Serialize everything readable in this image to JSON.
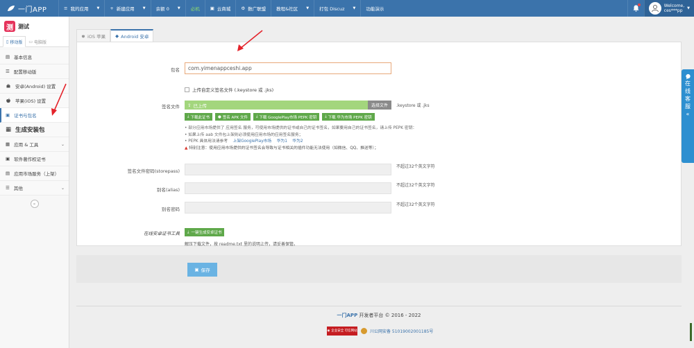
{
  "navbar": {
    "brand": "一门APP",
    "items": [
      {
        "label": "我的应用",
        "caret": true
      },
      {
        "label": "新建应用",
        "caret": true
      },
      {
        "label": "余额 0",
        "caret": true
      },
      {
        "label": "云商城"
      },
      {
        "label": "数广联盟"
      },
      {
        "label": "教程&社区",
        "caret": true
      },
      {
        "label": "打包 Discuz",
        "caret": true
      },
      {
        "label": "功能演示"
      }
    ],
    "live_label": "必机",
    "user_welcome": "Welcome,",
    "user_name": "ces***pp"
  },
  "sidebar": {
    "app_name": "测试",
    "app_logo_char": "测",
    "tabs": [
      "移动版",
      "电脑版"
    ],
    "menu": [
      {
        "label": "基本信息",
        "icon": "document-icon"
      },
      {
        "label": "配置移动版",
        "icon": "list-icon"
      },
      {
        "label": "安卓(Android) 设置",
        "icon": "android-icon"
      },
      {
        "label": "苹果(iOS) 设置",
        "icon": "apple-icon"
      },
      {
        "label": "证书与包名",
        "icon": "certificate-icon",
        "active": true
      },
      {
        "label": "生成安装包",
        "icon": "package-icon",
        "section": true
      },
      {
        "label": "应用 & 工具",
        "icon": "grid-icon",
        "chevron": true
      },
      {
        "label": "软件著作权证书",
        "icon": "copyright-icon"
      },
      {
        "label": "应用市场服务（上架）",
        "icon": "store-icon"
      },
      {
        "label": "其他",
        "icon": "menu-icon",
        "chevron": true
      }
    ]
  },
  "tabs": {
    "ios": "iOS 苹果",
    "android": "Android 安卓"
  },
  "form": {
    "package_label": "包名",
    "package_value": "com.yimenappceshi.app",
    "custom_sign_checkbox": "上传自定义签名文件 (.keystore 或 .jks)",
    "sign_file_label": "签名文件",
    "uploaded_text": "已上传",
    "choose_file_button": "选择文件",
    "file_types": ".keystore 或 .jks",
    "buttons": [
      "下载此证书",
      "签名 APK 文件",
      "下载 GooglePlay市场 PEPK 密钥",
      "下载 华为市场 PEPK 密钥"
    ],
    "notes": [
      "• 部分应用市场提供了 应用签名 服务，可使用市场提供的证书或自己的证书签名，如果要用自己的证书签名，请上传 PEPK 密钥：",
      "• 如果上传 aab 文件包上架则必须使用应用市场的应用签名服务；",
      "• PEPK 具体用法请参考",
      "特别注意：使用应用市场提供的证书签名会导致与证书相关的插件功能无法使用（如微信、QQ、推送等）；"
    ],
    "ref_links": [
      "上架GooglePlay市场",
      "华为1",
      "华为2"
    ],
    "storepass_label": "签名文件密码(storepass)",
    "alias_label": "别名(alias)",
    "alias_pass_label": "别名密码",
    "limit_hint": "不超过32个英文字符",
    "tool_label": "在线安卓证书工具",
    "tool_button": "一键生成安卓证书",
    "tool_note": "解压下载文件，按 readme.txt 里的说明上传，请妥善保管。"
  },
  "save_button": "保存",
  "footer": {
    "brand": "一门APP",
    "text": " 开发者平台 © 2016 - 2022",
    "badge_text": "企业安全 可信网站",
    "police_record": "川公网安备 51019002001185号"
  },
  "online_service": {
    "label_chars": [
      "在",
      "线",
      "客",
      "服"
    ],
    "arrow": "«"
  },
  "colors": {
    "navbar": "#3b73ab",
    "accent": "#3b73ab",
    "green_button": "#5fa84a",
    "save_button": "#6ab3e3",
    "service_tab": "#2d8fd0",
    "arrow_red": "#e4232b"
  }
}
